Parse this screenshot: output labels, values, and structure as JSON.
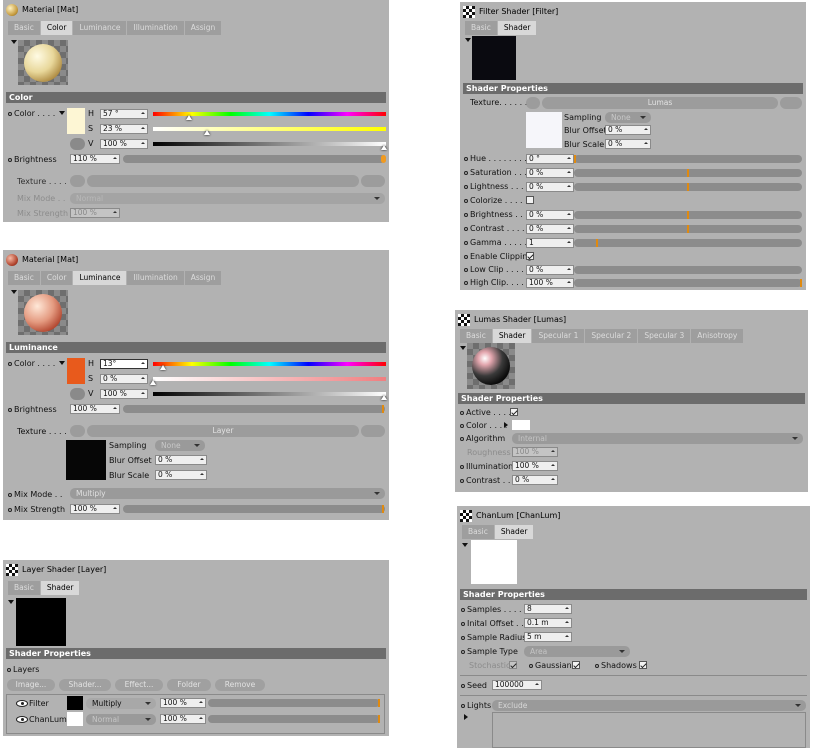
{
  "colors": {
    "panel": "#b2b2b2",
    "section_bar": "#6c6c6c",
    "marker": "#e08a10",
    "active_tab": "#d8d8d8"
  },
  "p1": {
    "title": "Material [Mat]",
    "tabs": [
      "Basic",
      "Color",
      "Luminance",
      "Illumination",
      "Assign"
    ],
    "active_tab": "Color",
    "section": "Color",
    "color_label": "Color . . . .",
    "swatch": "#fdf6d4",
    "h_label": "H",
    "h": "57 °",
    "h_pos": 0.16,
    "s_label": "S",
    "s": "23 %",
    "s_pos": 0.23,
    "v_label": "V",
    "v": "100 %",
    "v_pos": 1.0,
    "brightness_label": "Brightness",
    "brightness": "110 %",
    "brightness_pos": 1.0,
    "texture_label": "Texture . . . .",
    "mix_mode_label": "Mix Mode . .",
    "mix_mode": "Normal",
    "mix_strength_label": "Mix Strength",
    "mix_strength": "100 %"
  },
  "p2": {
    "title": "Material [Mat]",
    "tabs": [
      "Basic",
      "Color",
      "Luminance",
      "Illumination",
      "Assign"
    ],
    "active_tab": "Luminance",
    "section": "Luminance",
    "color_label": "Color . . . .",
    "swatch": "#e85a1c",
    "h_label": "H",
    "h": "13°",
    "h_pos": 0.04,
    "s_label": "S",
    "s": "0 %",
    "s_pos": 0.0,
    "v_label": "V",
    "v": "100 %",
    "v_pos": 1.0,
    "brightness_label": "Brightness",
    "brightness": "100 %",
    "brightness_pos": 1.0,
    "texture_label": "Texture . . . .",
    "texture_button": "Layer",
    "sampling_label": "Sampling",
    "sampling": "None",
    "blur_offset_label": "Blur Offset",
    "blur_offset": "0 %",
    "blur_scale_label": "Blur Scale",
    "blur_scale": "0 %",
    "mix_mode_label": "Mix Mode . .",
    "mix_mode": "Multiply",
    "mix_strength_label": "Mix Strength",
    "mix_strength": "100 %",
    "mix_strength_pos": 1.0
  },
  "p3": {
    "title": "Layer Shader [Layer]",
    "tabs": [
      "Basic",
      "Shader"
    ],
    "active_tab": "Shader",
    "section": "Shader Properties",
    "layers_label": "Layers",
    "buttons": [
      "Image...",
      "Shader...",
      "Effect...",
      "Folder",
      "Remove"
    ],
    "rows": [
      {
        "name": "Filter",
        "mode": "Multiply",
        "strength": "100 %",
        "swatch": "#000000"
      },
      {
        "name": "ChanLum",
        "mode": "Normal",
        "strength": "100 %",
        "swatch": "#ffffff"
      }
    ]
  },
  "p4": {
    "title": "Filter Shader [Filter]",
    "tabs": [
      "Basic",
      "Shader"
    ],
    "active_tab": "Shader",
    "section": "Shader Properties",
    "texture_label": "Texture. . . . . .",
    "texture_button": "Lumas",
    "sampling_label": "Sampling",
    "sampling": "None",
    "blur_offset_label": "Blur Offset",
    "blur_offset": "0 %",
    "blur_scale_label": "Blur Scale",
    "blur_scale": "0 %",
    "params": [
      {
        "label": "Hue . . . . . . . . .",
        "value": "0 °",
        "pos": 0.0
      },
      {
        "label": "Saturation . . . .",
        "value": "0 %",
        "pos": 0.5
      },
      {
        "label": "Lightness . . . .",
        "value": "0 %",
        "pos": 0.5
      },
      {
        "label": "Colorize . . . . .",
        "check": false
      },
      {
        "label": "Brightness . . . .",
        "value": "0 %",
        "pos": 0.5
      },
      {
        "label": "Contrast . . . . .",
        "value": "0 %",
        "pos": 0.5
      },
      {
        "label": "Gamma . . . . . .",
        "value": "1",
        "pos": 0.1
      },
      {
        "label": "Enable Clipping",
        "check": true
      },
      {
        "label": "Low Clip . . . . .",
        "value": "0 %",
        "pos": 0.0
      },
      {
        "label": "High Clip. . . . .",
        "value": "100 %",
        "pos": 1.0
      }
    ]
  },
  "p5": {
    "title": "Lumas Shader [Lumas]",
    "tabs": [
      "Basic",
      "Shader",
      "Specular 1",
      "Specular 2",
      "Specular 3",
      "Anisotropy"
    ],
    "active_tab": "Shader",
    "section": "Shader Properties",
    "active_label": "Active . . . .",
    "color_label": "Color . . . .",
    "algorithm_label": "Algorithm",
    "algorithm": "Internal",
    "roughness_label": "Roughness",
    "roughness": "100 %",
    "illumination_label": "Illumination",
    "illumination": "100 %",
    "contrast_label": "Contrast . . .",
    "contrast": "0 %"
  },
  "p6": {
    "title": "ChanLum [ChanLum]",
    "tabs": [
      "Basic",
      "Shader"
    ],
    "active_tab": "Shader",
    "section": "Shader Properties",
    "samples_label": "Samples . . . . .",
    "samples": "8",
    "initial_offset_label": "Inital Offset . . . .",
    "initial_offset": "0.1 m",
    "sample_radius_label": "Sample Radius",
    "sample_radius": "5 m",
    "sample_type_label": "Sample Type",
    "sample_type": "Area",
    "stochastic_label": "Stochastic",
    "gaussian_label": "Gaussian",
    "shadows_label": "Shadows",
    "seed_label": "Seed",
    "seed": "100000",
    "lights_label": "Lights",
    "lights": "Exclude"
  }
}
